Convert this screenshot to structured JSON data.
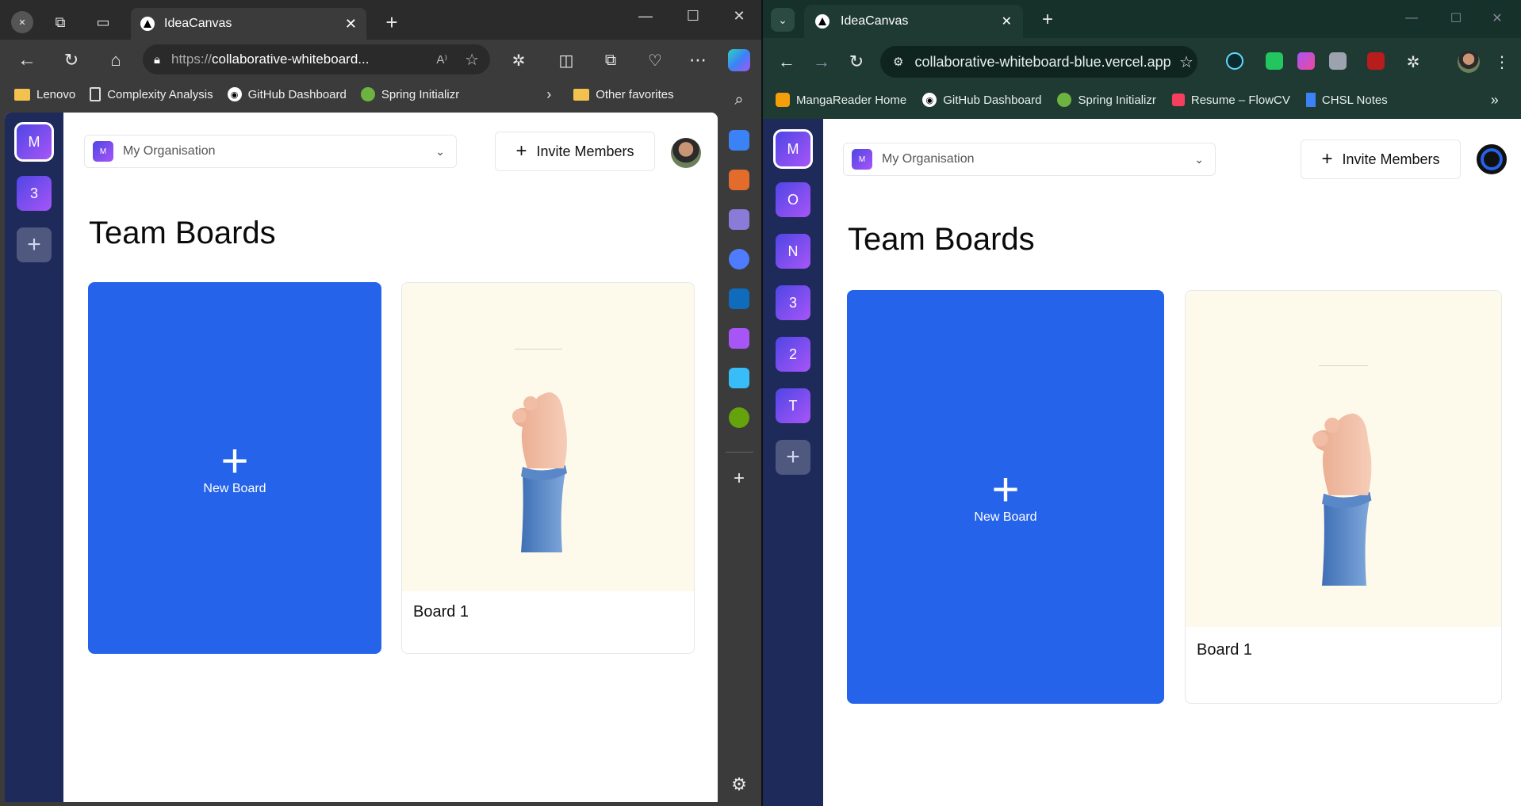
{
  "left_window": {
    "tab_title": "IdeaCanvas",
    "url_scheme": "https://",
    "url_host": "collaborative-whiteboard...",
    "bookmarks": [
      "Lenovo",
      "Complexity Analysis",
      "GitHub Dashboard",
      "Spring Initializr"
    ],
    "other_favorites": "Other favorites"
  },
  "right_window": {
    "tab_title": "IdeaCanvas",
    "url": "collaborative-whiteboard-blue.vercel.app",
    "bookmarks": [
      "MangaReader Home",
      "GitHub Dashboard",
      "Spring Initializr",
      "Resume – FlowCV",
      "CHSL Notes"
    ]
  },
  "app": {
    "org_switcher": {
      "label": "My Organisation",
      "badge": "M"
    },
    "invite_label": "Invite Members",
    "heading": "Team Boards",
    "new_board_label": "New Board",
    "board_title": "Board 1",
    "left_orgs": [
      "M",
      "3"
    ],
    "right_orgs": [
      "M",
      "O",
      "N",
      "3",
      "2",
      "T"
    ]
  },
  "colors": {
    "sidebar": "#1e2a5a",
    "new_board": "#2563eb",
    "board_thumb": "#fdfaeb",
    "org_gradient_start": "#4f46e5",
    "org_gradient_end": "#a855f7"
  }
}
